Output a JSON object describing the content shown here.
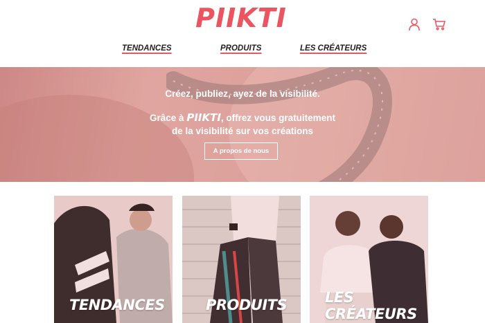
{
  "header": {
    "logo": "PIIKTI",
    "icons": {
      "account": "user-icon",
      "cart": "cart-icon"
    },
    "accent_color": "#ea5561"
  },
  "nav": {
    "items": [
      {
        "label": "TENDANCES"
      },
      {
        "label": "PRODUITS"
      },
      {
        "label": "LES CRÉATEURS"
      }
    ]
  },
  "hero": {
    "line1": "Créez, publiez, ayez de la visibilité.",
    "line2_prefix": "Grâce à ",
    "line2_brand": "PIIKTI",
    "line2_suffix": ", offrez vous gratuitement",
    "line3": "de la visibilité sur vos créations",
    "button_label": "A propos de nous"
  },
  "cards": [
    {
      "label": "TENDANCES"
    },
    {
      "label": "PRODUITS"
    },
    {
      "label": "LES CRÉATEURS"
    }
  ]
}
